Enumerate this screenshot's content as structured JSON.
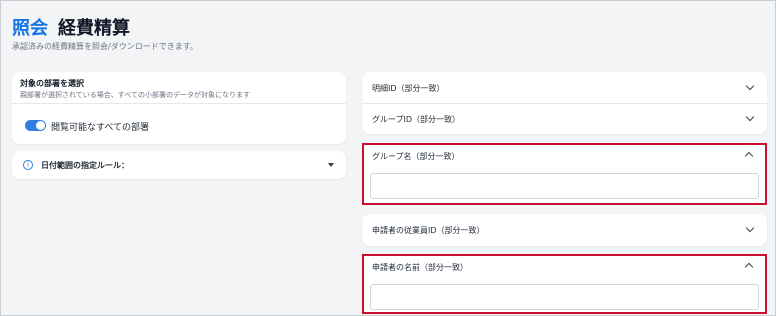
{
  "header": {
    "title_accent": "照会",
    "title_main": "経費精算",
    "subtitle": "承認済みの経費精算を照会/ダウンロードできます。"
  },
  "department": {
    "heading": "対象の部署を選択",
    "description": "親部署が選択されている場合、すべての小部署のデータが対象になります",
    "toggle_label": "閲覧可能なすべての部署",
    "toggle_on": true
  },
  "date_rule": {
    "label": "日付範囲の指定ルール：",
    "icon": "info-icon"
  },
  "filters": {
    "detail_id_label": "明細ID（部分一致）",
    "group_id_label": "グループID（部分一致）",
    "group_name_label": "グループ名（部分一致）",
    "group_name_value": "",
    "employee_id_label": "申請者の従業員ID（部分一致）",
    "applicant_name_label": "申請者の名前（部分一致）",
    "applicant_name_value": ""
  },
  "colors": {
    "accent": "#1473e6",
    "toggle": "#2f7de1",
    "highlight": "#c8102e"
  }
}
